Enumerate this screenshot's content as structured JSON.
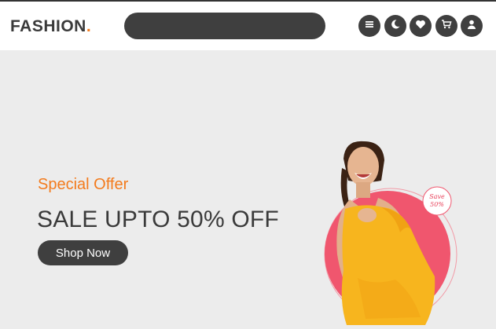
{
  "header": {
    "logo_text": "FASHION",
    "logo_dot": ".",
    "search": {
      "placeholder": "",
      "value": ""
    },
    "icons": [
      "menu-icon",
      "moon-icon",
      "heart-icon",
      "cart-icon",
      "user-icon"
    ]
  },
  "hero": {
    "kicker": "Special Offer",
    "headline": "SALE UPTO 50% OFF",
    "cta_label": "Shop Now",
    "badge_line1": "Save",
    "badge_line2": "50%"
  },
  "colors": {
    "accent": "#f37b1d",
    "dark": "#3f3f3f",
    "background": "#ececec",
    "circle": "#f0566e",
    "dress": "#f7b51e"
  }
}
